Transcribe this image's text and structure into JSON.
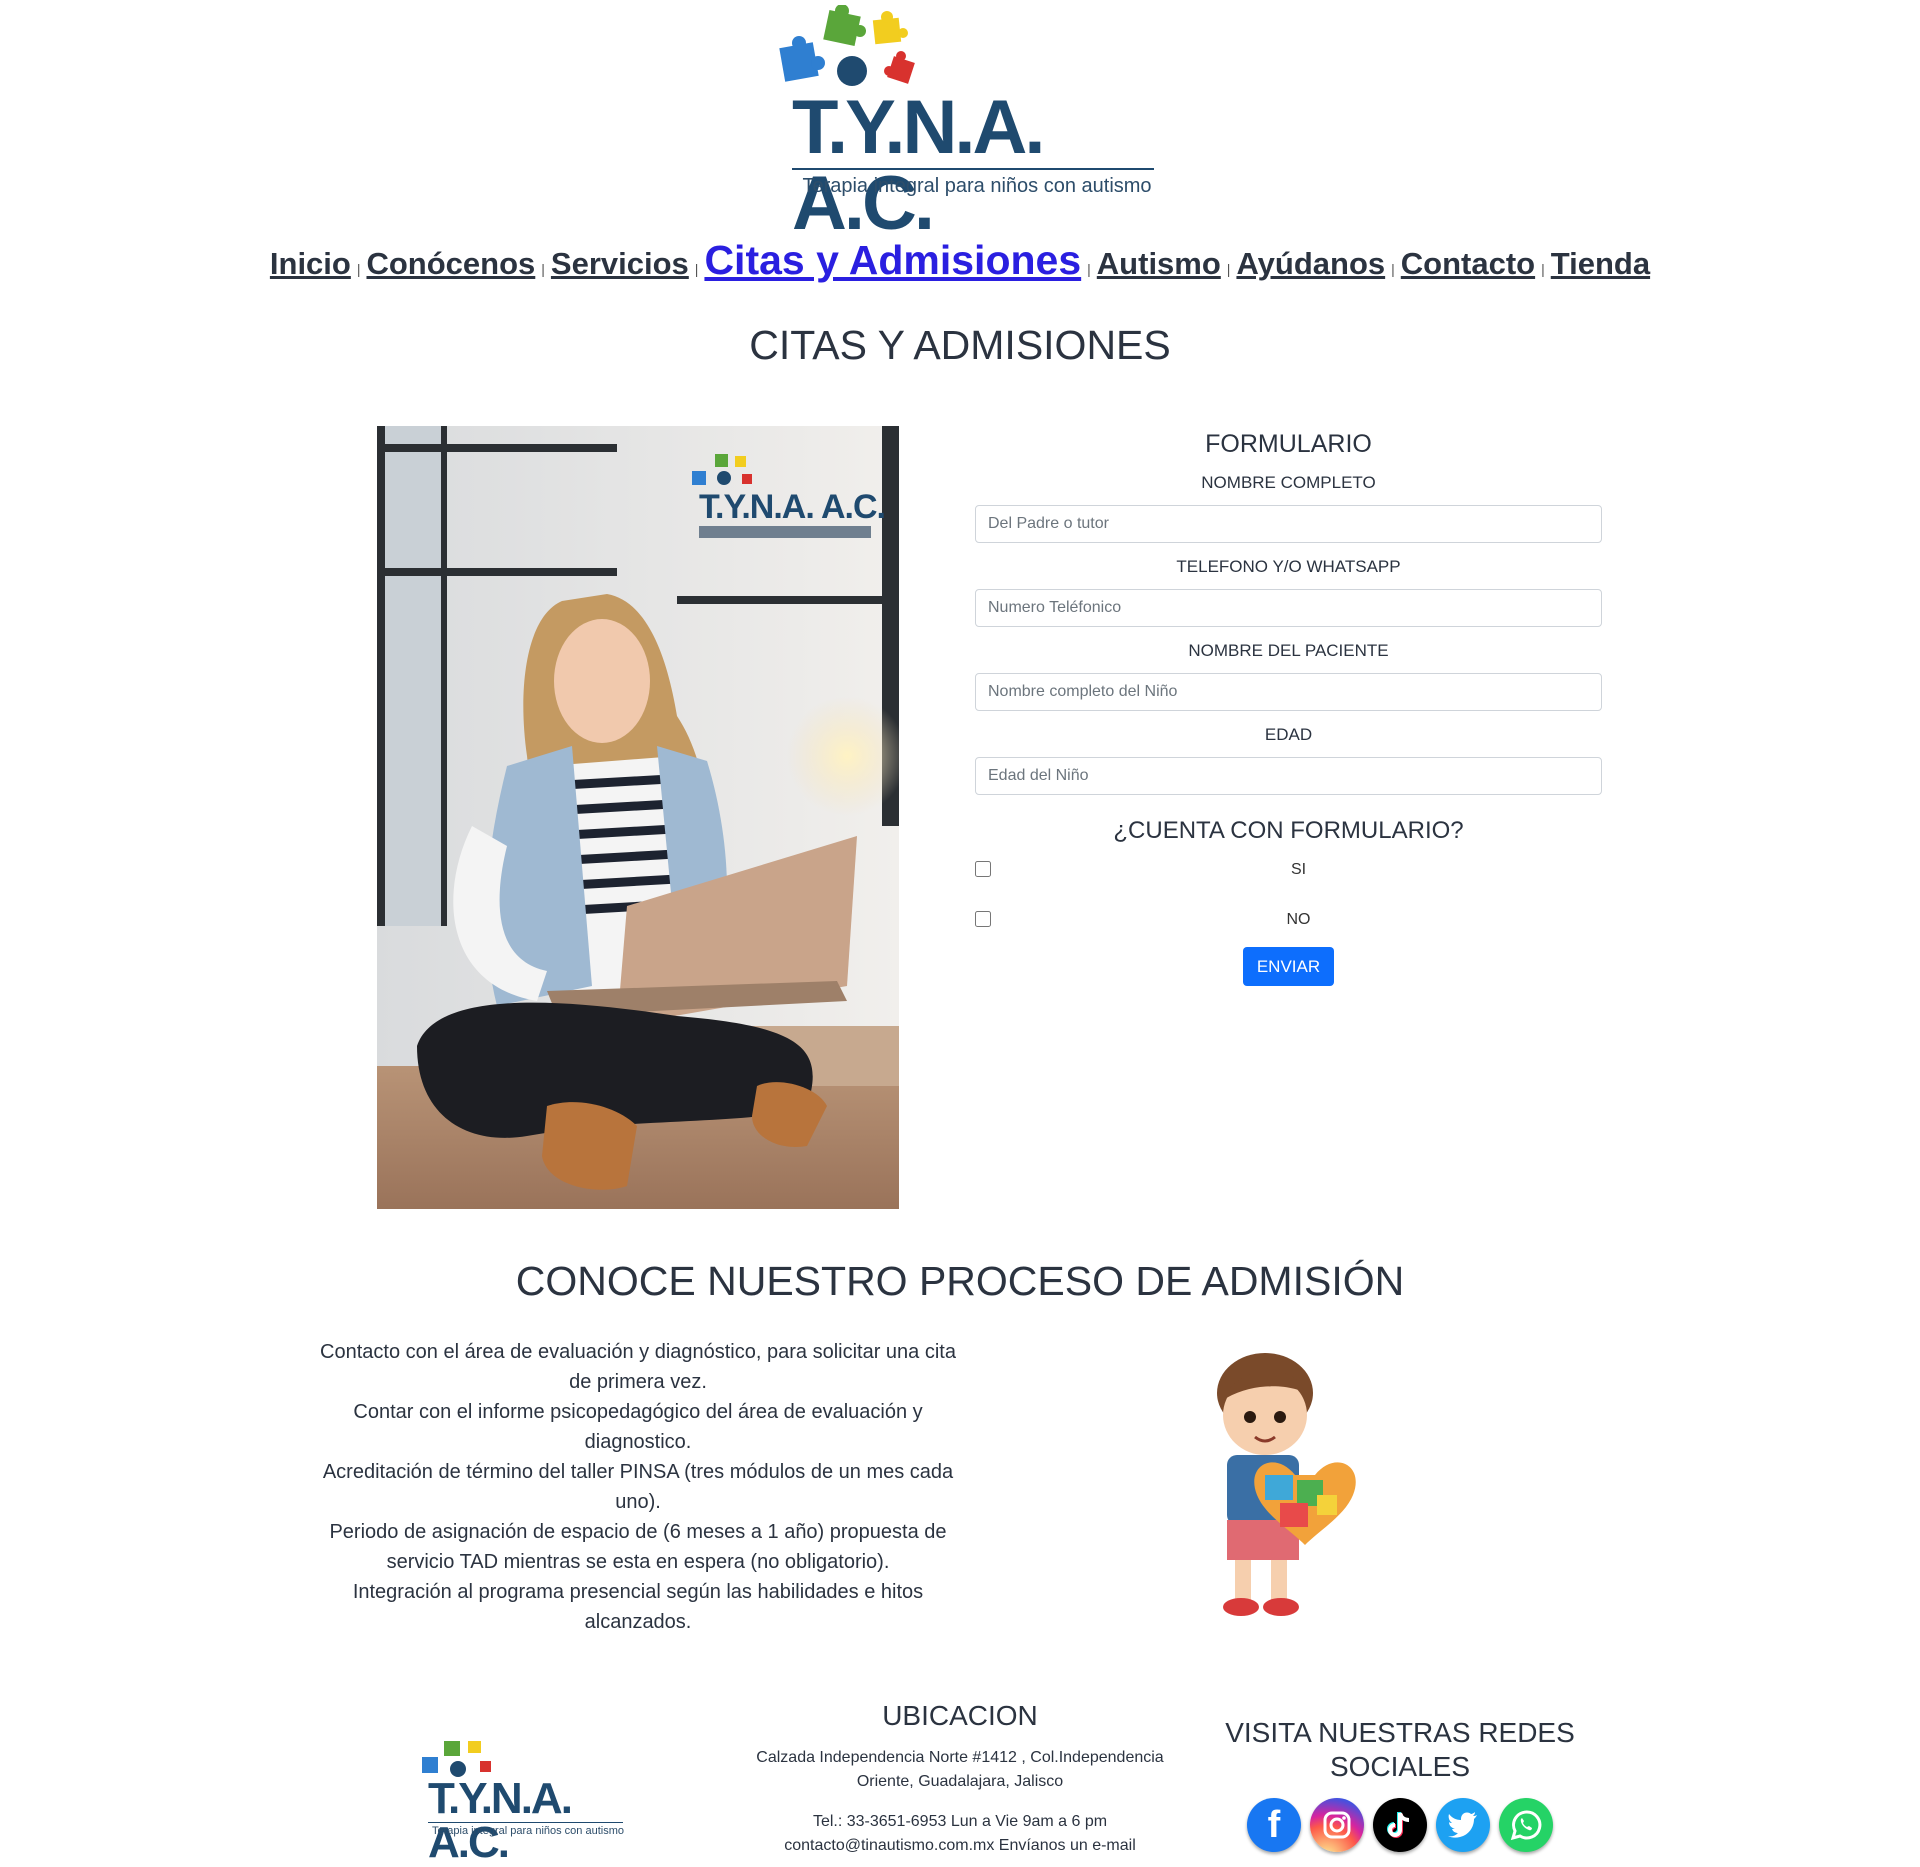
{
  "logo": {
    "brand": "T.Y.N.A. A.C.",
    "tagline": "Terapia integral para niños con autismo"
  },
  "nav": {
    "items": [
      {
        "label": "Inicio"
      },
      {
        "label": "Conócenos"
      },
      {
        "label": "Servicios"
      },
      {
        "label": "Citas y Admisiones",
        "active": true
      },
      {
        "label": "Autismo"
      },
      {
        "label": "Ayúdanos"
      },
      {
        "label": "Contacto"
      },
      {
        "label": "Tienda"
      }
    ],
    "separator": "|",
    "active_color": "#2a1fe0"
  },
  "page_title": "CITAS Y ADMISIONES",
  "hero": {
    "logo_brand": "T.Y.N.A. A.C.",
    "logo_tagline": "Terapia integral para niños con autismo"
  },
  "form": {
    "title": "FORMULARIO",
    "fields": [
      {
        "label": "NOMBRE COMPLETO",
        "placeholder": "Del Padre o tutor",
        "value": ""
      },
      {
        "label": "TELEFONO Y/O WHATSAPP",
        "placeholder": "Numero Teléfonico",
        "value": ""
      },
      {
        "label": "NOMBRE DEL PACIENTE",
        "placeholder": "Nombre completo del Niño",
        "value": ""
      },
      {
        "label": "EDAD",
        "placeholder": "Edad del Niño",
        "value": ""
      }
    ],
    "question": "¿CUENTA CON FORMULARIO?",
    "options": [
      {
        "label": "SI",
        "checked": false
      },
      {
        "label": "NO",
        "checked": false
      }
    ],
    "submit_label": "ENVIAR",
    "submit_color": "#0d6efd"
  },
  "process": {
    "title": "CONOCE NUESTRO PROCESO DE ADMISIÓN",
    "steps": [
      "Contacto con el área de evaluación y diagnóstico, para solicitar una cita de primera vez.",
      "Contar con el informe psicopedagógico del área de evaluación y diagnostico.",
      "Acreditación de término del taller PINSA (tres módulos de un mes cada uno).",
      "Periodo de asignación de espacio de (6 meses a 1 año) propuesta de servicio TAD mientras se esta en espera (no obligatorio).",
      "Integración al programa presencial según las habilidades e hitos alcanzados."
    ]
  },
  "footer": {
    "location_title": "UBICACION",
    "address": "Calzada Independencia Norte #1412 , Col.Independencia Oriente, Guadalajara, Jalisco",
    "phone_line": "Tel.: 33-3651-6953 Lun a Vie 9am a 6 pm",
    "email_line": "contacto@tinautismo.com.mx Envíanos un e-mail",
    "social_title": "VISITA NUESTRAS REDES SOCIALES",
    "social_icons": [
      {
        "name": "facebook-icon",
        "color": "#1877f2"
      },
      {
        "name": "instagram-icon",
        "color": "#d6249f"
      },
      {
        "name": "tiktok-icon",
        "color": "#000000"
      },
      {
        "name": "twitter-icon",
        "color": "#1da1f2"
      },
      {
        "name": "whatsapp-icon",
        "color": "#25d366"
      }
    ]
  }
}
